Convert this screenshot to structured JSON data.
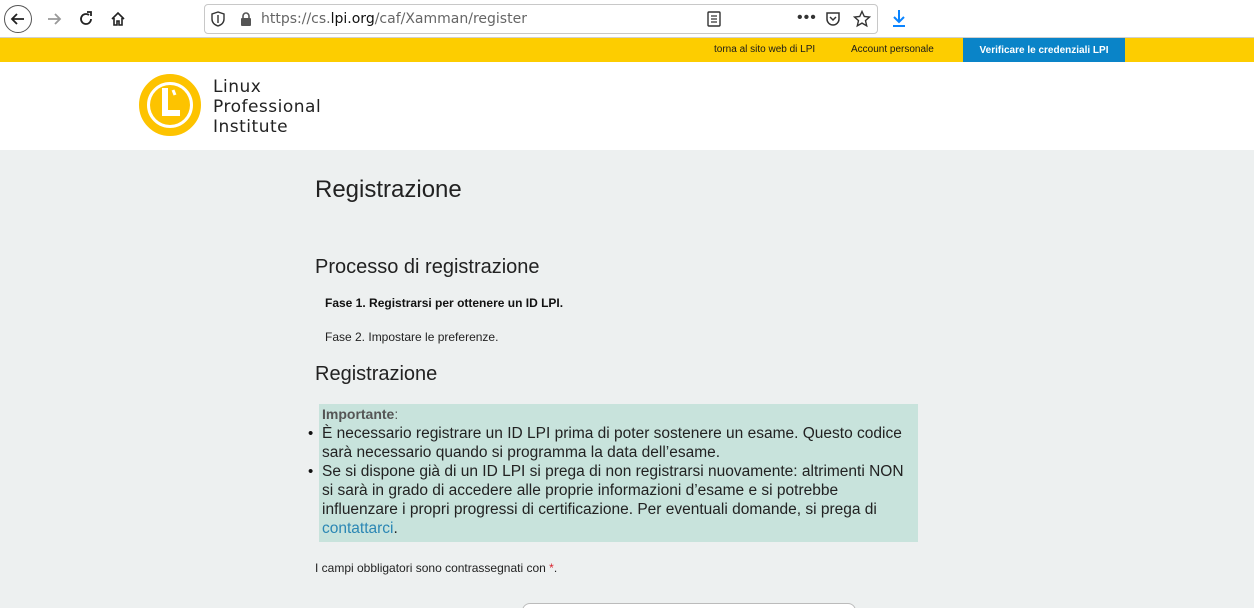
{
  "browser": {
    "url_prefix": "https://cs.",
    "url_domain": "lpi.org",
    "url_path": "/caf/Xamman/register",
    "more_label": "•••"
  },
  "util_bar": {
    "link_site": "torna al sito web di LPI",
    "link_account": "Account personale",
    "cta": "Verificare le credenziali LPI"
  },
  "logo": {
    "line1": "Linux",
    "line2": "Professional",
    "line3": "Institute"
  },
  "main": {
    "title": "Registrazione",
    "process_heading": "Processo di registrazione",
    "step1": "Fase 1. Registrarsi per ottenere un ID LPI.",
    "step2": "Fase 2. Impostare le preferenze.",
    "registration_heading": "Registrazione",
    "notice": {
      "label": "Importante",
      "colon": ":",
      "item1": "È necessario registrare un ID LPI prima di poter sostenere un esame. Questo codice sarà necessario quando si programma la data dell’esame.",
      "item2_text": "Se si dispone già di un ID LPI si prega di non registrarsi nuovamente: altrimenti NON si sarà in grado di accedere alle proprie informazioni d’esame e si potrebbe influenzare i propri progressi di certificazione. Per eventuali domande, si prega di ",
      "item2_link": "contattarci",
      "item2_end": "."
    },
    "required_note": "I campi obbligatori sono contrassegnati con ",
    "required_mark": "*",
    "required_end": "."
  },
  "colors": {
    "util_bar": "#fdcd00",
    "cta": "#0a84c8",
    "notice_bg": "#c8e3dc",
    "link": "#2b87b4",
    "logo": "#fdc300"
  }
}
